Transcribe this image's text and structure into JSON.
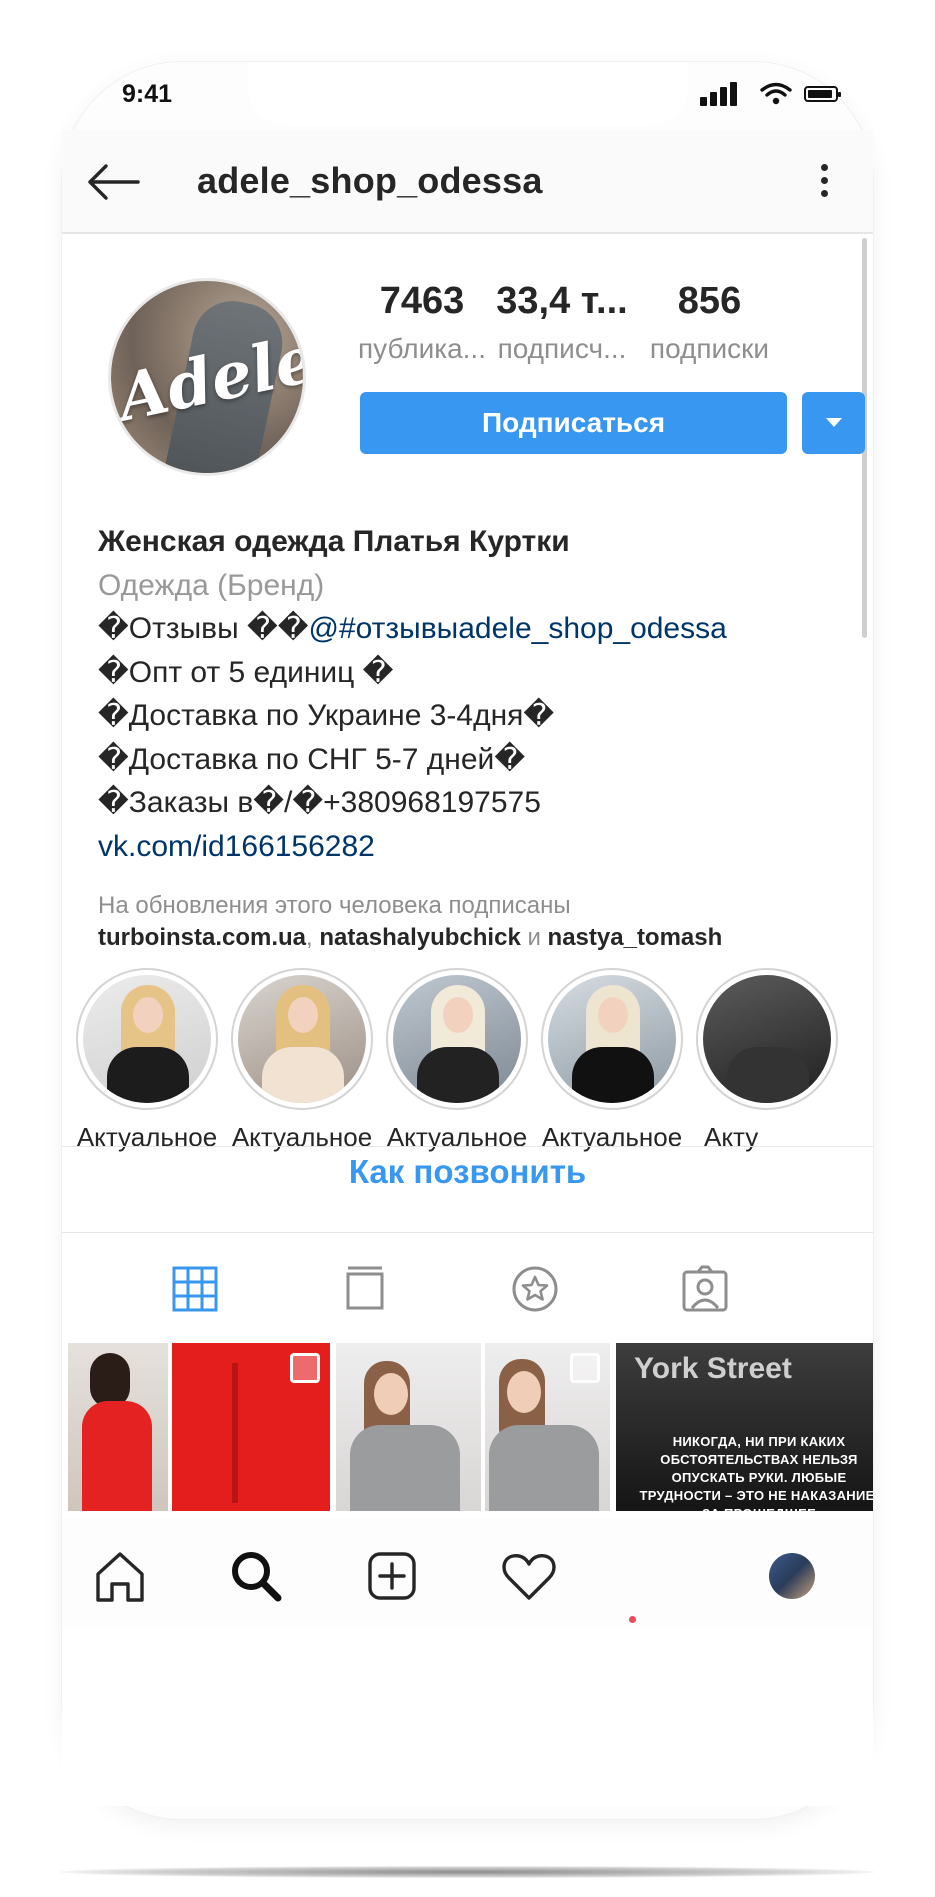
{
  "status_bar": {
    "time": "9:41"
  },
  "header": {
    "username": "adele_shop_odessa"
  },
  "profile": {
    "avatar_text": "Adele",
    "stats": [
      {
        "value": "7463",
        "label": "публика..."
      },
      {
        "value": "33,4 т...",
        "label": "подписч..."
      },
      {
        "value": "856",
        "label": "подписки"
      }
    ],
    "follow_label": "Подписаться"
  },
  "bio": {
    "name": "Женская одежда Платья Куртки",
    "category": "Одежда (Бренд)",
    "lines": [
      "�Отзывы ��@#отзывыadele_shop_odessa",
      "�Опт от 5 единиц �",
      "�Доставка по Украине 3-4дня�",
      "�Доставка по СНГ 5-7 дней�",
      "�Заказы в�/�+380968197575"
    ],
    "link": "vk.com/id166156282"
  },
  "followed_by": {
    "intro": "На обновления этого человека подписаны",
    "account1": "turboinsta.com.ua",
    "sep1": ", ",
    "account2": "natashalyubchick",
    "sep2": " и ",
    "account3": "nastya_tomash"
  },
  "highlights": [
    {
      "label": "Актуальное"
    },
    {
      "label": "Актуальное"
    },
    {
      "label": "Актуальное"
    },
    {
      "label": "Актуальное"
    },
    {
      "label": "Акту"
    }
  ],
  "call_link": "Как позвонить",
  "grid_posts": {
    "post5_sign": "York Street",
    "post5_quote": "НИКОГДА, НИ ПРИ КАКИХ ОБСТОЯТЕЛЬСТВАХ НЕЛЬЗЯ ОПУСКАТЬ РУКИ. ЛЮБЫЕ ТРУДНОСТИ – ЭТО НЕ НАКАЗАНИЕ, ЗА ПРОШЕДШЕЕ"
  },
  "colors": {
    "accent": "#3897f0",
    "link": "#003569",
    "muted": "#8e8e8e",
    "notification": "#ed4956"
  },
  "icons": {
    "header": [
      "back-arrow-icon",
      "more-vertical-icon"
    ],
    "tabs": [
      "grid-icon",
      "feed-icon",
      "guides-star-icon",
      "tagged-icon"
    ],
    "nav": [
      "home-icon",
      "search-icon",
      "new-post-icon",
      "activity-heart-icon",
      "profile-avatar"
    ]
  }
}
